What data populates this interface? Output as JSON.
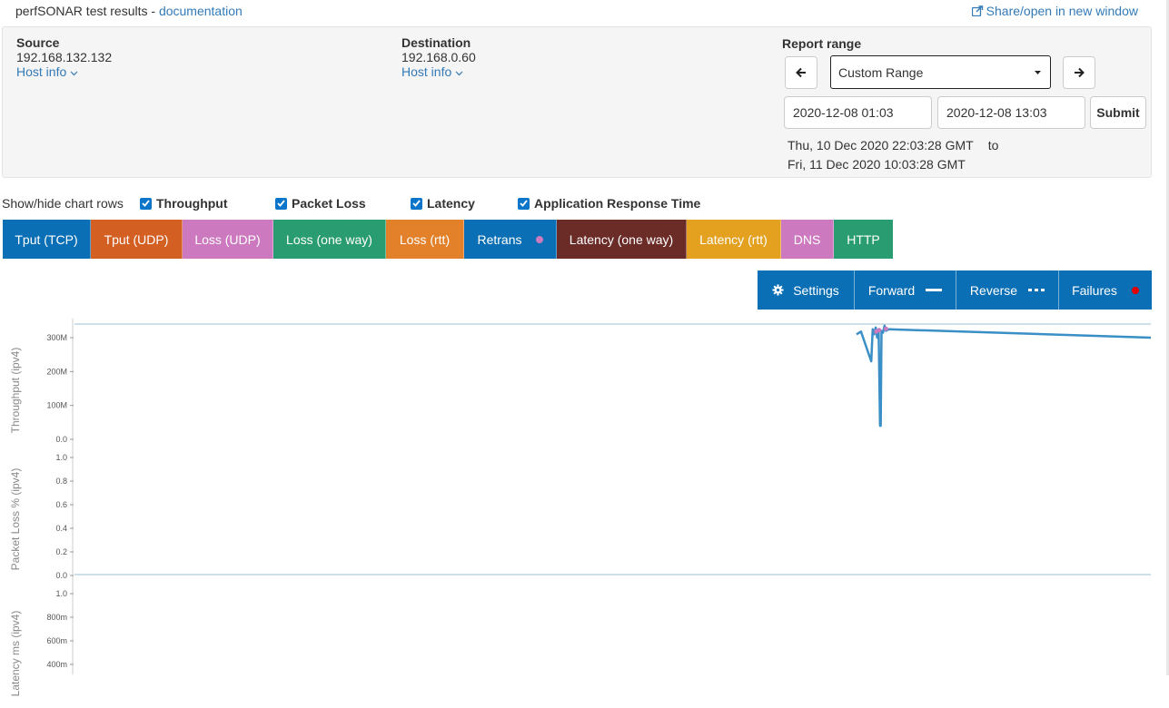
{
  "header": {
    "title": "perfSONAR test results - ",
    "doc_link": "documentation",
    "share_link": "Share/open in new window"
  },
  "source": {
    "label": "Source",
    "ip": "192.168.132.132",
    "host_info": "Host info"
  },
  "destination": {
    "label": "Destination",
    "ip": "192.168.0.60",
    "host_info": "Host info"
  },
  "report_range": {
    "label": "Report range",
    "selected": "Custom Range",
    "start_date": "2020-12-08 01:03",
    "end_date": "2020-12-08 13:03",
    "submit_label": "Submit",
    "range_from": "Thu, 10 Dec 2020 22:03:28 GMT",
    "range_to_word": "to",
    "range_to": "Fri, 11 Dec 2020 10:03:28 GMT"
  },
  "toggles": {
    "label": "Show/hide chart rows",
    "items": [
      {
        "label": "Throughput",
        "checked": true
      },
      {
        "label": "Packet Loss",
        "checked": true
      },
      {
        "label": "Latency",
        "checked": true
      },
      {
        "label": "Application Response Time",
        "checked": true
      }
    ]
  },
  "legend": [
    {
      "label": "Tput (TCP)",
      "color": "#0a6fb4"
    },
    {
      "label": "Tput (UDP)",
      "color": "#d35f22"
    },
    {
      "label": "Loss (UDP)",
      "color": "#cc79bf"
    },
    {
      "label": "Loss (one way)",
      "color": "#2a9c71"
    },
    {
      "label": "Loss (rtt)",
      "color": "#e2812a"
    },
    {
      "label": "Retrans",
      "color": "#0a6fb4",
      "dot": "#cc79bf"
    },
    {
      "label": "Latency (one way)",
      "color": "#6b2c28"
    },
    {
      "label": "Latency (rtt)",
      "color": "#e3a11f"
    },
    {
      "label": "DNS",
      "color": "#cc79bf"
    },
    {
      "label": "HTTP",
      "color": "#2a9c71"
    }
  ],
  "controls": {
    "settings": "Settings",
    "forward": "Forward",
    "reverse": "Reverse",
    "failures": "Failures",
    "failures_dot_color": "#e00000"
  },
  "chart_data": [
    {
      "type": "line",
      "ylabel": "Throughput (ipv4)",
      "yticks": [
        "0.0",
        "100M",
        "200M",
        "300M"
      ],
      "ylim": [
        0,
        350
      ],
      "series_color": "#3a8fc6",
      "retrans_color": "#cc79bf",
      "points": [
        [
          0.0,
          310
        ],
        [
          0.015,
          318
        ],
        [
          0.05,
          230
        ],
        [
          0.055,
          325
        ],
        [
          0.06,
          310
        ],
        [
          0.065,
          330
        ],
        [
          0.07,
          300
        ],
        [
          0.075,
          325
        ],
        [
          0.08,
          40
        ],
        [
          0.082,
          40
        ],
        [
          0.085,
          320
        ],
        [
          0.09,
          315
        ],
        [
          0.095,
          335
        ],
        [
          0.1,
          320
        ],
        [
          0.11,
          325
        ],
        [
          1.0,
          300
        ]
      ]
    },
    {
      "type": "line",
      "ylabel": "Packet Loss % (ipv4)",
      "yticks": [
        "0.0",
        "0.2",
        "0.4",
        "0.6",
        "0.8",
        "1.0"
      ],
      "ylim": [
        0,
        1
      ]
    },
    {
      "type": "line",
      "ylabel": "Latency ms (ipv4)",
      "yticks": [
        "400m",
        "600m",
        "800m",
        "1.0"
      ],
      "ylim": [
        0,
        1
      ]
    }
  ]
}
